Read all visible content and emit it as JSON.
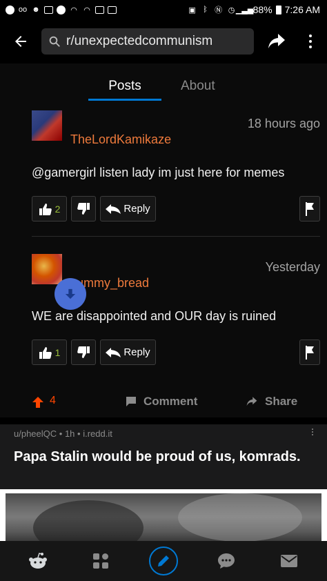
{
  "status_bar": {
    "battery": "88%",
    "time": "7:26 AM"
  },
  "app_bar": {
    "search_text": "r/unexpectedcommunism"
  },
  "tabs": [
    {
      "label": "Posts",
      "active": true
    },
    {
      "label": "About",
      "active": false
    }
  ],
  "comments": [
    {
      "username": "TheLordKamikaze",
      "time": "18 hours ago",
      "body": "@gamergirl listen lady im just here for memes",
      "upvotes": "2",
      "reply_label": "Reply"
    },
    {
      "username": "cummy_bread",
      "time": "Yesterday",
      "body": "WE are disappointed and OUR day is ruined",
      "upvotes": "1",
      "reply_label": "Reply"
    }
  ],
  "post_actions": {
    "score": "4",
    "comment_label": "Comment",
    "share_label": "Share"
  },
  "next_post": {
    "author": "u/pheelQC",
    "age": "1h",
    "domain": "i.redd.it",
    "title": "Papa Stalin would be proud of us, komrads."
  },
  "colors": {
    "accent": "#0079d3",
    "username": "#ee7a3c",
    "upvote": "#ff4500",
    "downvote_active": "#4a6fd6"
  }
}
